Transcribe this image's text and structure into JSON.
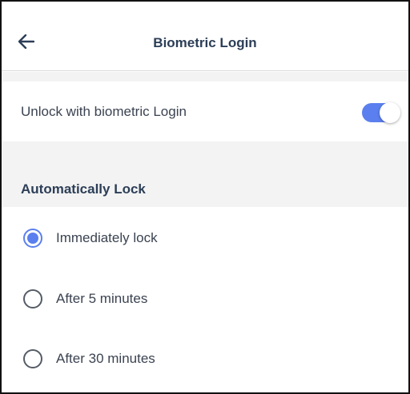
{
  "header": {
    "title": "Biometric Login",
    "back_icon": "arrow-left-icon"
  },
  "unlock": {
    "label": "Unlock with biometric Login",
    "enabled": true,
    "accent": "#5b7fee"
  },
  "auto_lock": {
    "section_title": "Automatically Lock",
    "options": [
      {
        "label": "Immediately lock",
        "selected": true
      },
      {
        "label": "After 5 minutes",
        "selected": false
      },
      {
        "label": "After 30 minutes",
        "selected": false
      }
    ]
  }
}
